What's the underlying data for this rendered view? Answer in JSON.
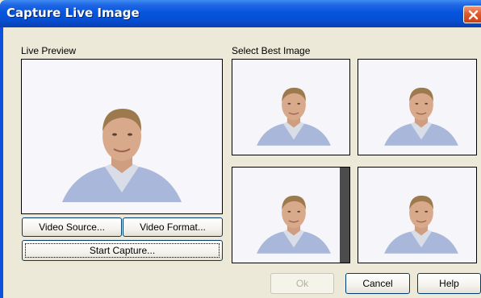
{
  "window": {
    "title": "Capture Live Image"
  },
  "live_preview": {
    "label": "Live Preview",
    "video_source_label": "Video Source...",
    "video_format_label": "Video Format...",
    "start_capture_label": "Start Capture..."
  },
  "best_image": {
    "label": "Select Best Image",
    "thumbnails": [
      "thumbnail-1",
      "thumbnail-2",
      "thumbnail-3",
      "thumbnail-4"
    ]
  },
  "footer": {
    "ok_label": "Ok",
    "cancel_label": "Cancel",
    "help_label": "Help"
  },
  "colors": {
    "titlebar": "#0755de",
    "close_button": "#e05a2c",
    "dialog_bg": "#ece9d8"
  },
  "icons": {
    "close": "close-icon"
  }
}
